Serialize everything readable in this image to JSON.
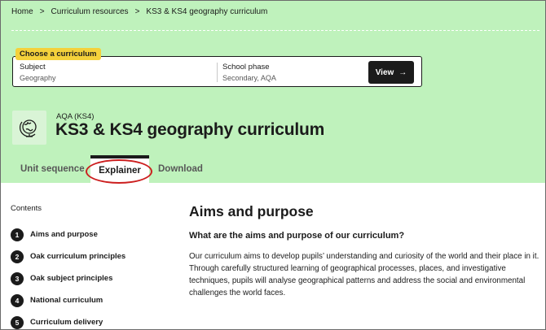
{
  "breadcrumbs": [
    {
      "label": "Home"
    },
    {
      "label": "Curriculum resources"
    },
    {
      "label": "KS3 & KS4 geography curriculum"
    }
  ],
  "breadcrumb_separator": ">",
  "chooser": {
    "chip": "Choose a curriculum",
    "subject_label": "Subject",
    "subject_value": "Geography",
    "phase_label": "School phase",
    "phase_value": "Secondary, AQA",
    "view_label": "View",
    "view_arrow": "→"
  },
  "header": {
    "eyebrow": "AQA (KS4)",
    "title": "KS3 & KS4 geography curriculum",
    "icon": "globe-icon"
  },
  "tabs": [
    {
      "label": "Unit sequence",
      "active": false
    },
    {
      "label": "Explainer",
      "active": true
    },
    {
      "label": "Download",
      "active": false
    }
  ],
  "contents": {
    "heading": "Contents",
    "items": [
      {
        "num": "1",
        "label": "Aims and purpose"
      },
      {
        "num": "2",
        "label": "Oak curriculum principles"
      },
      {
        "num": "3",
        "label": "Oak subject principles"
      },
      {
        "num": "4",
        "label": "National curriculum"
      },
      {
        "num": "5",
        "label": "Curriculum delivery"
      }
    ]
  },
  "main": {
    "heading": "Aims and purpose",
    "subheading": "What are the aims and purpose of our curriculum?",
    "paragraph": "Our curriculum aims to develop pupils’ understanding and curiosity of the world and their place in it. Through carefully structured learning of geographical processes, places, and investigative techniques, pupils will analyse geographical patterns and address the social and environmental challenges the world faces."
  },
  "colors": {
    "hero_bg": "#bff2bc",
    "chip_bg": "#f4d13b",
    "annotation_circle": "#cc1f1f",
    "text": "#1b1b1b"
  }
}
